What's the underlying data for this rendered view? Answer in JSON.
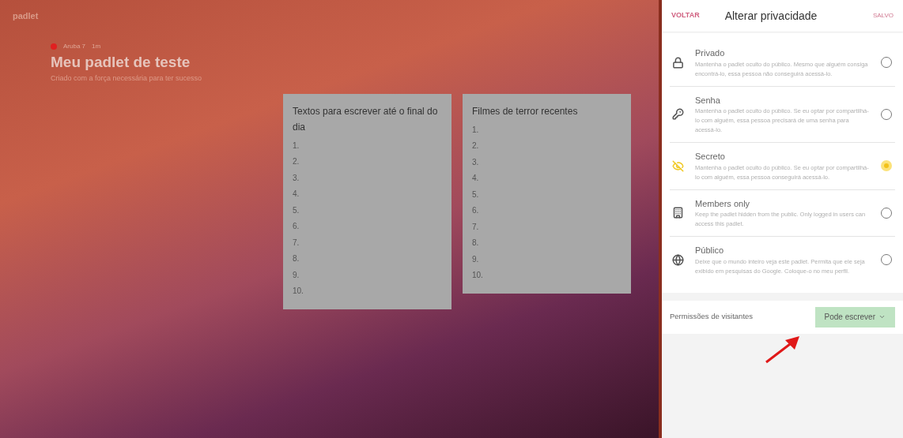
{
  "board": {
    "logo": "padlet",
    "author": "Aruba 7",
    "time": "1m",
    "title": "Meu padlet de teste",
    "subtitle": "Criado com a força necessária para ter sucesso",
    "posts": [
      {
        "title": "Textos para escrever até o final do dia",
        "lines": [
          "1.",
          "2.",
          "3.",
          "4.",
          "5.",
          "6.",
          "7.",
          "8.",
          "9.",
          "10."
        ]
      },
      {
        "title": "Filmes de terror recentes",
        "lines": [
          "1.",
          "2.",
          "3.",
          "4.",
          "5.",
          "6.",
          "7.",
          "8.",
          "9.",
          "10."
        ]
      }
    ]
  },
  "panel": {
    "back": "VOLTAR",
    "title": "Alterar privacidade",
    "status": "SALVO",
    "options": [
      {
        "kind": "lock",
        "label": "Privado",
        "description": "Mantenha o padlet oculto do público. Mesmo que alguém consiga encontrá-lo, essa pessoa não conseguirá acessá-lo.",
        "selected": false
      },
      {
        "kind": "key",
        "label": "Senha",
        "description": "Mantenha o padlet oculto do público. Se eu optar por compartilhá-lo com alguém, essa pessoa precisará de uma senha para acessá-lo.",
        "selected": false
      },
      {
        "kind": "hidden",
        "label": "Secreto",
        "description": "Mantenha o padlet oculto do público. Se eu optar por compartilhá-lo com alguém, essa pessoa conseguirá acessá-lo.",
        "selected": true
      },
      {
        "kind": "building",
        "label": "Members only",
        "description": "Keep the padlet hidden from the public. Only logged in users can access this padlet.",
        "selected": false
      },
      {
        "kind": "globe",
        "label": "Público",
        "description": "Deixe que o mundo inteiro veja este padlet. Permita que ele seja exibido em pesquisas do Google. Coloque-o no meu perfil.",
        "selected": false
      }
    ],
    "permissions_label": "Permissões de visitantes",
    "permissions_value": "Pode escrever"
  }
}
